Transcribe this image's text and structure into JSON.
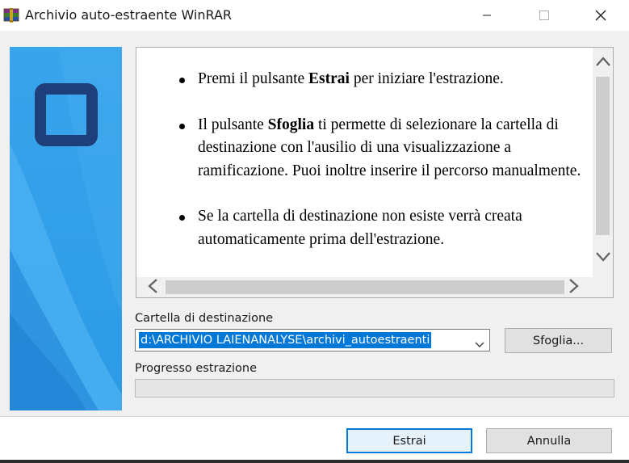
{
  "window": {
    "title": "Archivio auto-estraente WinRAR",
    "icon": "winrar-books-icon",
    "controls": [
      "minimize-icon",
      "maximize-icon",
      "close-icon"
    ]
  },
  "info": {
    "items": [
      {
        "parts": [
          {
            "t": "Premi il pulsante ",
            "b": false
          },
          {
            "t": "Estrai",
            "b": true
          },
          {
            "t": " per iniziare l'estrazione.",
            "b": false
          }
        ]
      },
      {
        "parts": [
          {
            "t": "Il pulsante ",
            "b": false
          },
          {
            "t": "Sfoglia",
            "b": true
          },
          {
            "t": " ti permette di selezionare la cartella di destinazione con l'ausilio di una visualizzazione a ramificazione. Puoi inoltre inserire il percorso manualmente.",
            "b": false
          }
        ]
      },
      {
        "parts": [
          {
            "t": "Se la cartella di destinazione non esiste verrà creata automaticamente prima dell'estrazione.",
            "b": false
          }
        ]
      }
    ]
  },
  "destination": {
    "label": "Cartella di destinazione",
    "value": "d:\\ARCHIVIO LAIENANALYSE\\archivi_autoestraenti",
    "browse_label": "Sfoglia..."
  },
  "progress": {
    "label": "Progresso estrazione",
    "value": 0
  },
  "buttons": {
    "extract_label": "Estrai",
    "cancel_label": "Annulla"
  },
  "colors": {
    "accent": "#0078d7",
    "banner_light": "#3aa6ee",
    "banner_dark": "#1f3f7a"
  }
}
